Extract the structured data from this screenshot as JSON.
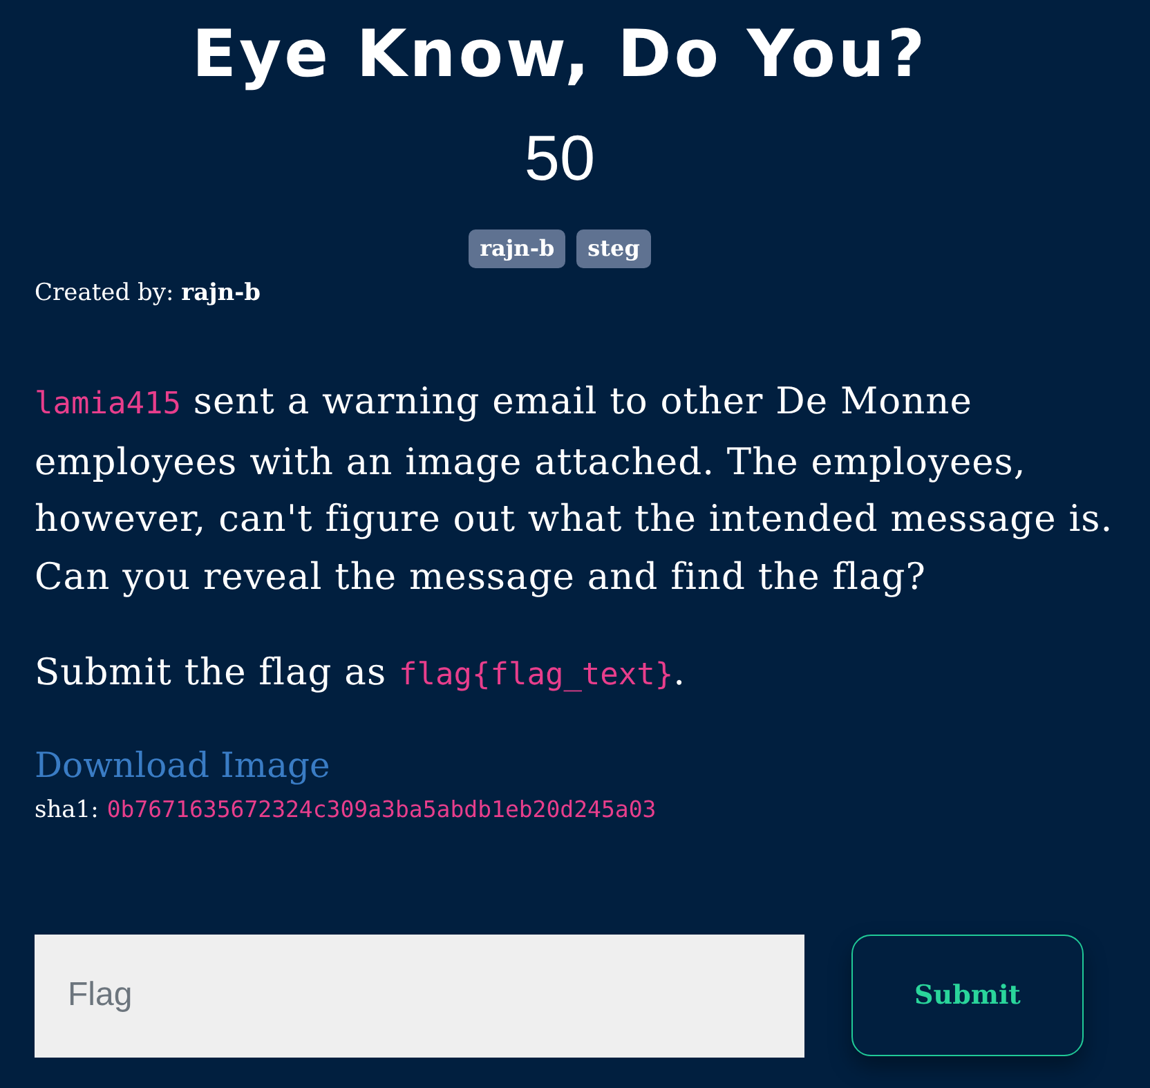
{
  "challenge": {
    "title": "Eye Know, Do You?",
    "points": "50",
    "tags": [
      "rajn-b",
      "steg"
    ],
    "created_by": "Created by: **rajn-b**"
  },
  "description": [
    [
      {
        "kind": "code",
        "text": "lamia415"
      },
      {
        "kind": "text",
        "text": " sent a warning email to other De Monne employees with an image attached. The employees, however, can't figure out what the intended message is. Can you reveal the message and find the flag?"
      }
    ],
    [
      {
        "kind": "text",
        "text": "Submit the flag as "
      },
      {
        "kind": "code",
        "text": "flag{flag_text}"
      },
      {
        "kind": "text",
        "text": "."
      }
    ]
  ],
  "download": {
    "link": "Download Image",
    "hash_label": "sha1:",
    "hash": "0b7671635672324c309a3ba5abdb1eb20d245a03"
  },
  "form": {
    "flag_field": {
      "placeholder": "Flag"
    },
    "submit_button": "Submit"
  }
}
